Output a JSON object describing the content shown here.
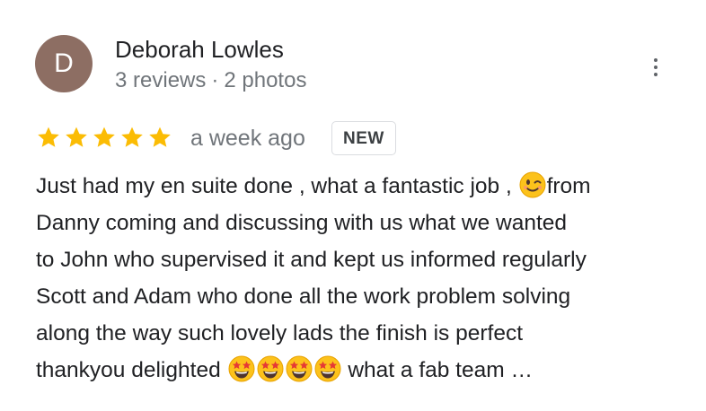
{
  "author": {
    "initial": "D",
    "avatar_color": "#8d6e63",
    "name": "Deborah Lowles",
    "reviews": "3 reviews",
    "separator": "·",
    "photos": "2 photos"
  },
  "menu": {
    "icon": "more-vertical-icon"
  },
  "rating": {
    "stars": 5,
    "max": 5,
    "star_color": "#fbbc04"
  },
  "time": "a week ago",
  "badge": "NEW",
  "review": {
    "line1_a": "Just had my en suite done , what a fantastic job ,",
    "line1_emoji": "winking-face-emoji",
    "line1_b": "from",
    "line2": "Danny coming and discussing with us what we wanted",
    "line3": "to John who supervised it and kept us informed regularly",
    "line4": "Scott and Adam who done all the work problem solving",
    "line5": "along the way such lovely lads the finish is perfect",
    "line6_a": "thankyou delighted",
    "line6_emojis": [
      "star-struck-emoji",
      "star-struck-emoji",
      "star-struck-emoji",
      "star-struck-emoji"
    ],
    "line6_b": "what a fab team",
    "more": "…"
  }
}
